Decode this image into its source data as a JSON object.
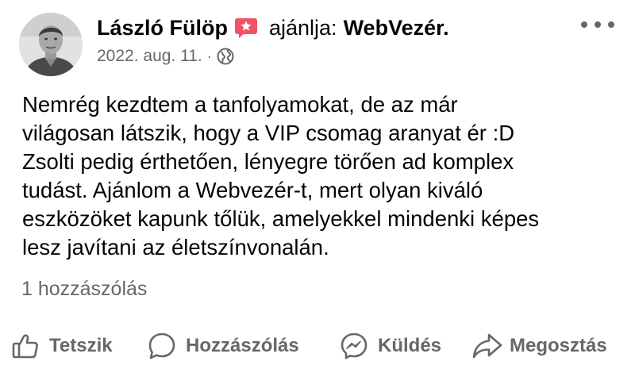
{
  "post": {
    "author": "László Fülöp",
    "recommends": "ajánlja:",
    "page_name": "WebVezér.",
    "date": "2022. aug. 11.",
    "separator": "·",
    "text_lines": [
      "Nemrég kezdtem a tanfolyamokat, de az már",
      "világosan látszik, hogy a VIP csomag aranyat ér :D",
      "Zsolti pedig érthetően, lényegre törően ad komplex",
      "tudást. Ajánlom a Webvezér-t, mert olyan kiváló",
      "eszközöket kapunk tőlük, amelyekkel mindenki képes",
      "lesz javítani az életszínvonalán."
    ],
    "comment_count": "1 hozzászólás"
  },
  "actions": {
    "like": "Tetszik",
    "comment": "Hozzászólás",
    "send": "Küldés",
    "share": "Megosztás"
  },
  "icons": {
    "badge": "recommendation-star-badge-icon",
    "globe": "globe-icon",
    "more": "more-options-icon",
    "like": "thumbs-up-icon",
    "comment": "comment-bubble-icon",
    "send": "messenger-icon",
    "share": "share-arrow-icon"
  },
  "colors": {
    "badge": "#f25268",
    "secondary_text": "#65676b",
    "primary_text": "#050505"
  }
}
